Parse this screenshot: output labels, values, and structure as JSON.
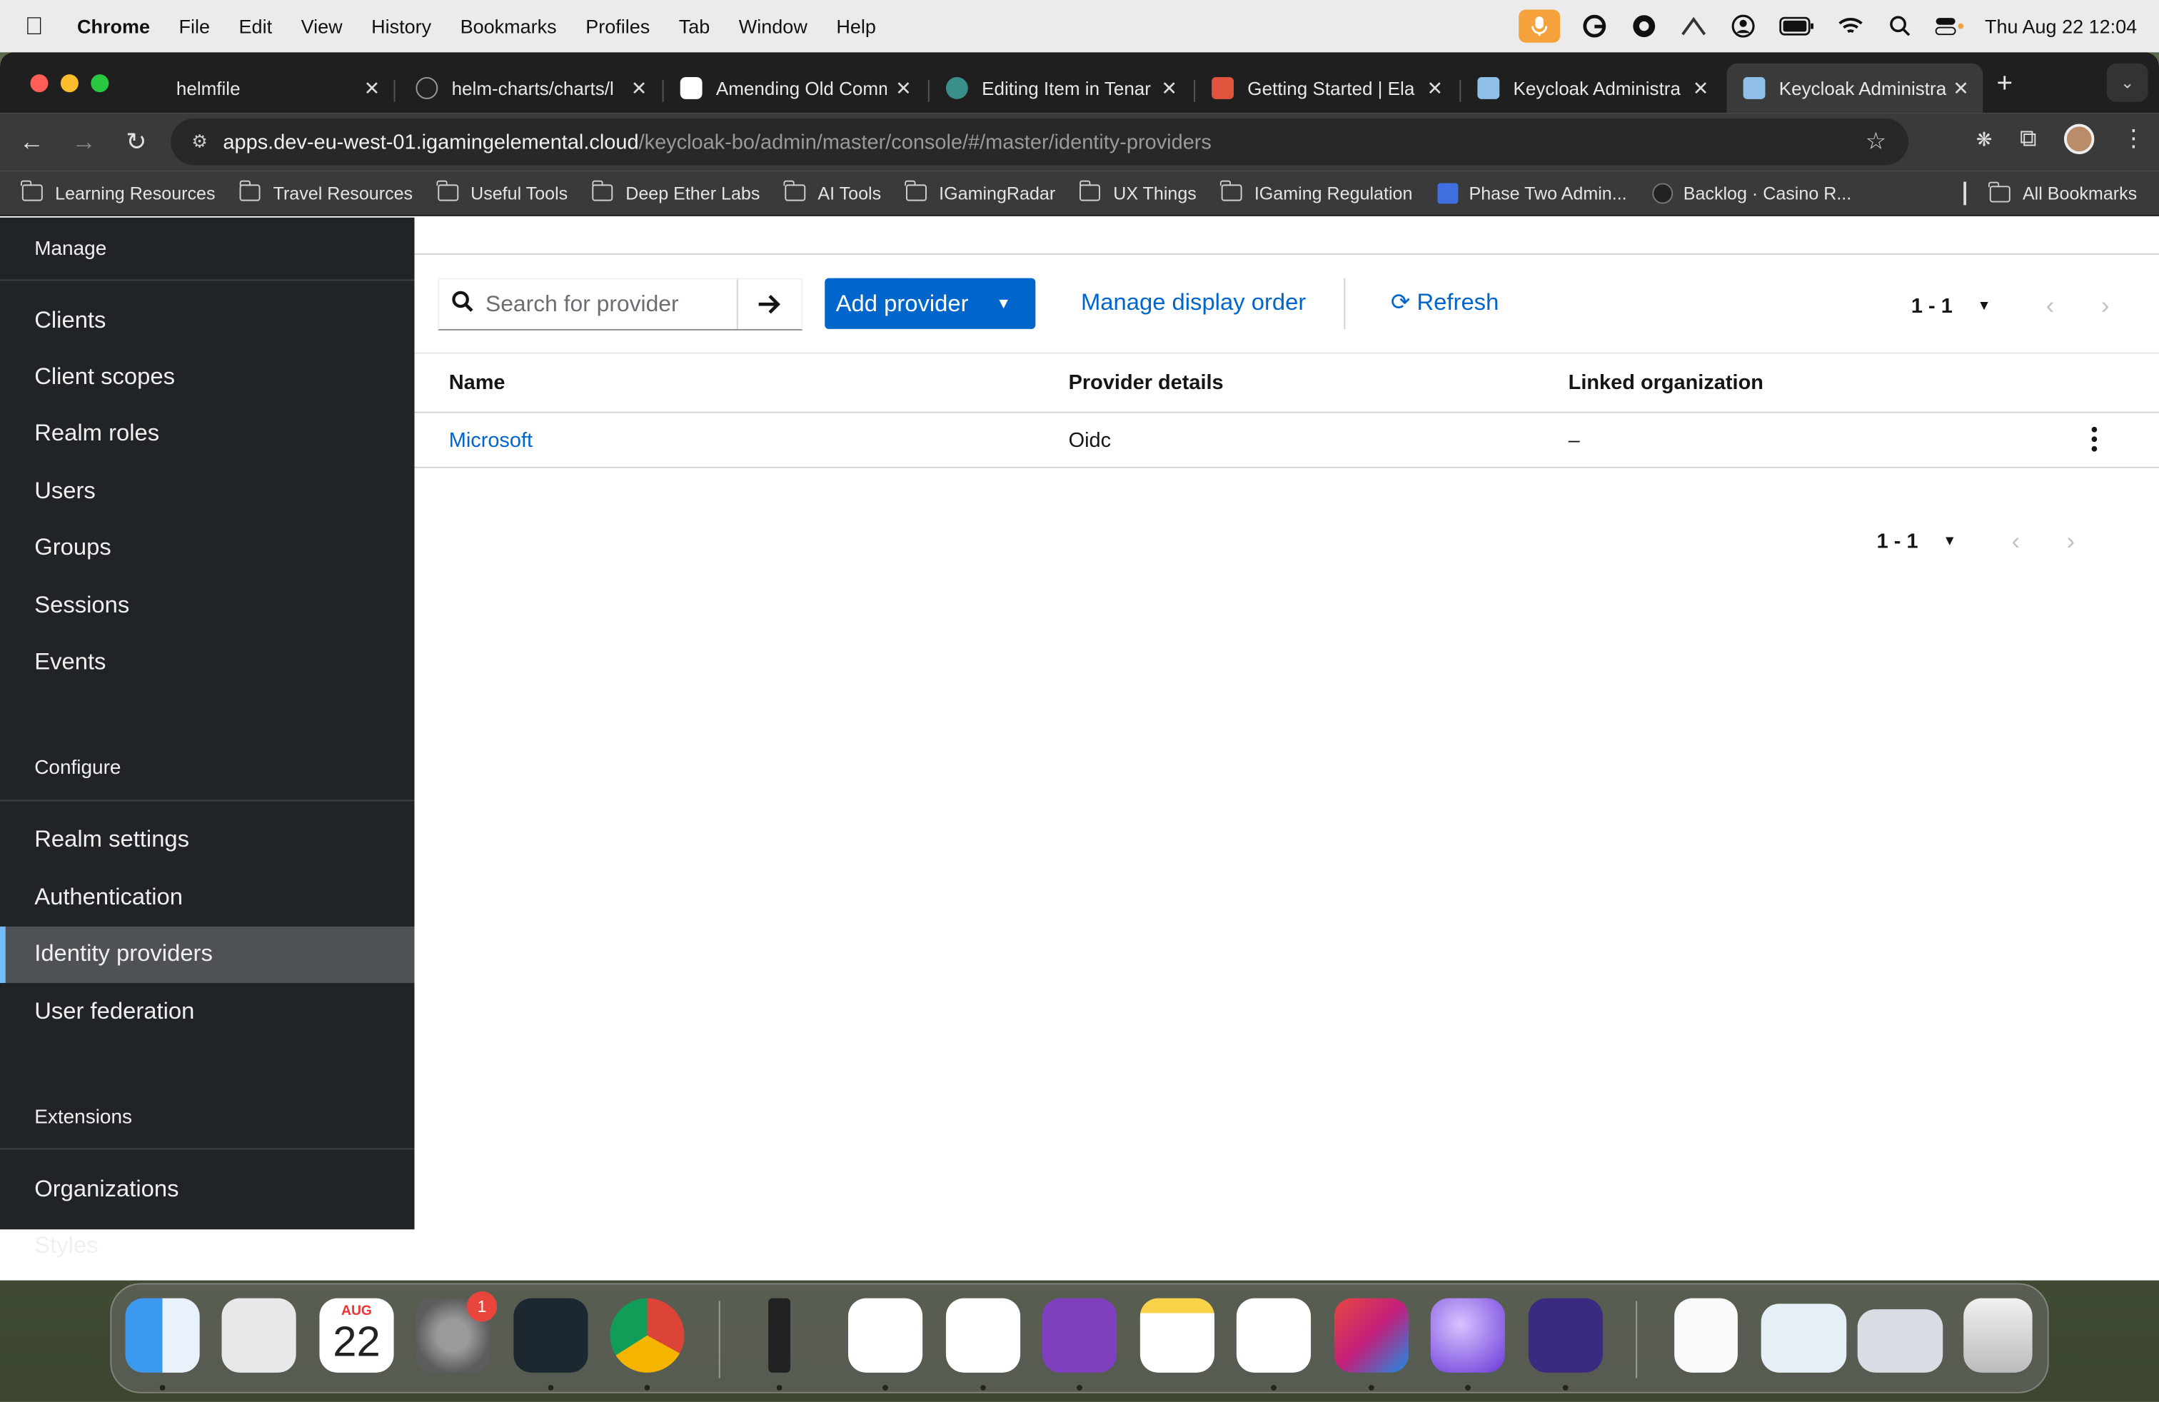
{
  "menubar": {
    "app": "Chrome",
    "items": [
      "File",
      "Edit",
      "View",
      "History",
      "Bookmarks",
      "Profiles",
      "Tab",
      "Window",
      "Help"
    ],
    "clock": "Thu Aug 22  12:04"
  },
  "tabs": [
    {
      "title": "helmfile",
      "icon": "none-icon"
    },
    {
      "title": "helm-charts/charts/l",
      "icon": "github-icon"
    },
    {
      "title": "Amending Old Comm",
      "icon": "openai-icon"
    },
    {
      "title": "Editing Item in Tenar",
      "icon": "globe-icon"
    },
    {
      "title": "Getting Started | Ela",
      "icon": "elastic-icon"
    },
    {
      "title": "Keycloak Administra",
      "icon": "keycloak-icon"
    },
    {
      "title": "Keycloak Administra",
      "icon": "keycloak-icon",
      "active": true
    }
  ],
  "omnibox": {
    "host": "apps.dev-eu-west-01.igamingelemental.cloud",
    "path": "/keycloak-bo/admin/master/console/#/master/identity-providers"
  },
  "bookmarks": [
    {
      "label": "Learning Resources",
      "type": "folder"
    },
    {
      "label": "Travel Resources",
      "type": "folder"
    },
    {
      "label": "Useful Tools",
      "type": "folder"
    },
    {
      "label": "Deep Ether Labs",
      "type": "folder"
    },
    {
      "label": "AI Tools",
      "type": "folder"
    },
    {
      "label": "IGamingRadar",
      "type": "folder"
    },
    {
      "label": "UX Things",
      "type": "folder"
    },
    {
      "label": "IGaming Regulation",
      "type": "folder"
    },
    {
      "label": "Phase Two Admin...",
      "type": "link"
    },
    {
      "label": "Backlog · Casino R...",
      "type": "github"
    }
  ],
  "all_bookmarks": "All Bookmarks",
  "sidebar": {
    "sections": [
      {
        "title": "Manage",
        "items": [
          "Clients",
          "Client scopes",
          "Realm roles",
          "Users",
          "Groups",
          "Sessions",
          "Events"
        ]
      },
      {
        "title": "Configure",
        "items": [
          "Realm settings",
          "Authentication",
          "Identity providers",
          "User federation"
        ]
      },
      {
        "title": "Extensions",
        "items": [
          "Organizations",
          "Styles"
        ]
      }
    ],
    "active_item": "Identity providers"
  },
  "toolbar": {
    "search_placeholder": "Search for provider",
    "add_provider_label": "Add provider",
    "manage_order_label": "Manage display order",
    "refresh_label": "Refresh",
    "pagination": "1 - 1"
  },
  "table": {
    "columns": [
      "Name",
      "Provider details",
      "Linked organization"
    ],
    "rows": [
      {
        "name": "Microsoft",
        "details": "Oidc",
        "organization": "–"
      }
    ]
  },
  "bottom_pagination": "1 - 1",
  "dock": {
    "calendar_month": "AUG",
    "calendar_day": "22",
    "settings_badge": "1",
    "accent": "#0066cc"
  }
}
